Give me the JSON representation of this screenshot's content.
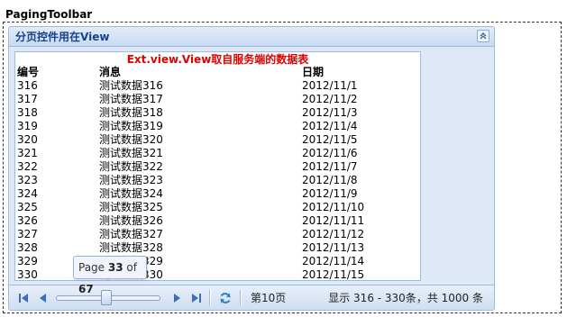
{
  "page_title": "PagingToolbar",
  "panel": {
    "title": "分页控件用在View",
    "collapse_icon": "double-chevron-up-icon"
  },
  "view": {
    "title": "Ext.view.View取自服务端的数据表",
    "columns": [
      "编号",
      "消息",
      "日期"
    ],
    "rows": [
      [
        "316",
        "测试数据316",
        "2012/11/1"
      ],
      [
        "317",
        "测试数据317",
        "2012/11/2"
      ],
      [
        "318",
        "测试数据318",
        "2012/11/3"
      ],
      [
        "319",
        "测试数据319",
        "2012/11/4"
      ],
      [
        "320",
        "测试数据320",
        "2012/11/5"
      ],
      [
        "321",
        "测试数据321",
        "2012/11/6"
      ],
      [
        "322",
        "测试数据322",
        "2012/11/7"
      ],
      [
        "323",
        "测试数据323",
        "2012/11/8"
      ],
      [
        "324",
        "测试数据324",
        "2012/11/9"
      ],
      [
        "325",
        "测试数据325",
        "2012/11/10"
      ],
      [
        "326",
        "测试数据326",
        "2012/11/11"
      ],
      [
        "327",
        "测试数据327",
        "2012/11/12"
      ],
      [
        "328",
        "测试数据328",
        "2012/11/13"
      ],
      [
        "329",
        "测试数据329",
        "2012/11/14"
      ],
      [
        "330",
        "测试数据330",
        "2012/11/15"
      ]
    ]
  },
  "tooltip": {
    "prefix": "Page ",
    "current": "33",
    "middle": " of ",
    "total": "67"
  },
  "toolbar": {
    "page_label": "第10页",
    "display_info": "显示 316 - 330条，共 1000 条",
    "slider_value": 0.48
  },
  "colors": {
    "accent": "#15428b",
    "view_title": "#e00000",
    "panel_border": "#99bbe8"
  }
}
